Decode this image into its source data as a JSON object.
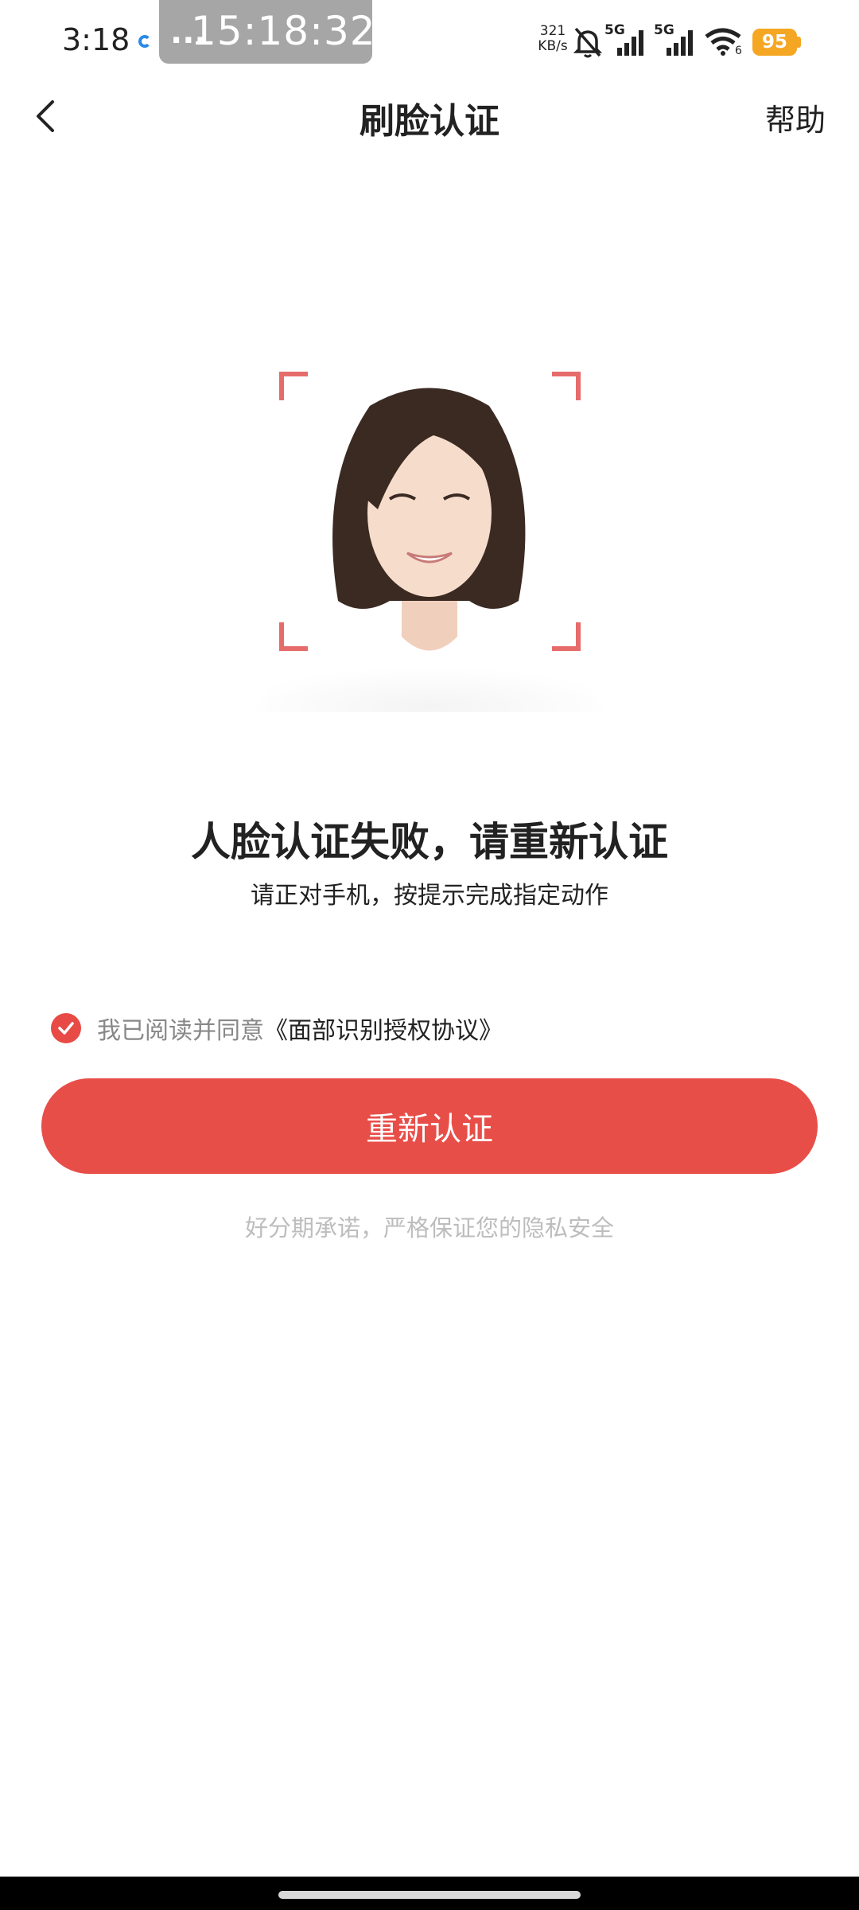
{
  "status_bar": {
    "time": "3:18",
    "clock_dots": "...",
    "clock_text": "15:18:32",
    "speed_value": "321",
    "speed_unit": "KB/s",
    "network_1": "5G",
    "network_2": "5G",
    "wifi_badge": "6",
    "battery": "95",
    "battery_color": "#f5a623"
  },
  "header": {
    "title": "刷脸认证",
    "help": "帮助"
  },
  "result": {
    "title": "人脸认证失败，请重新认证",
    "subtitle": "请正对手机，按提示完成指定动作"
  },
  "agreement": {
    "checked": true,
    "text": "我已阅读并同意",
    "link": "《面部识别授权协议》"
  },
  "button": {
    "label": "重新认证",
    "color": "#e84e48"
  },
  "privacy_note": "好分期承诺，严格保证您的隐私安全",
  "accent_color": "#e66c6c"
}
